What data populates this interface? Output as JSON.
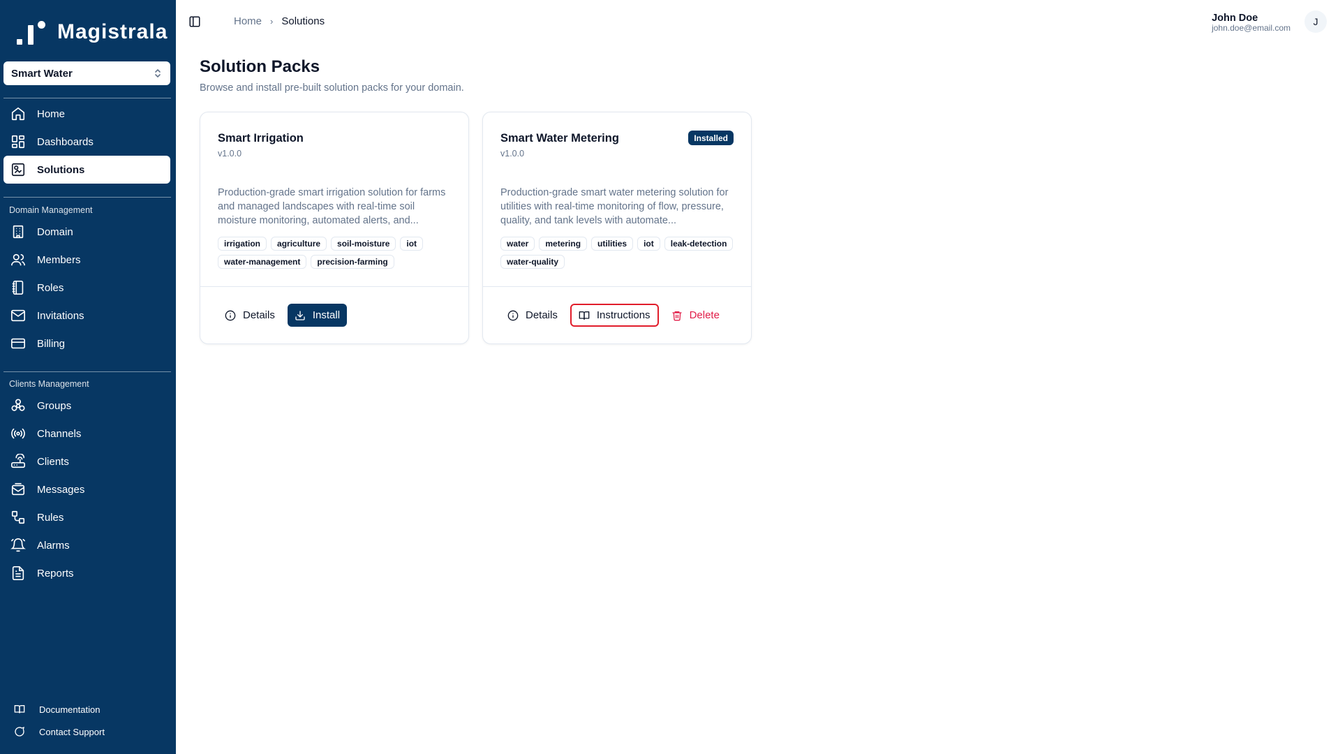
{
  "app": {
    "logo_text": "Magistrala"
  },
  "domain_selector": {
    "value": "Smart Water"
  },
  "sidebar": {
    "main_items": [
      {
        "label": "Home",
        "icon": "home-icon"
      },
      {
        "label": "Dashboards",
        "icon": "dashboard-icon"
      },
      {
        "label": "Solutions",
        "icon": "solutions-icon",
        "active": true
      }
    ],
    "domain_section_label": "Domain Management",
    "domain_items": [
      {
        "label": "Domain",
        "icon": "building-icon"
      },
      {
        "label": "Members",
        "icon": "users-icon"
      },
      {
        "label": "Roles",
        "icon": "notebook-icon"
      },
      {
        "label": "Invitations",
        "icon": "mail-icon"
      },
      {
        "label": "Billing",
        "icon": "credit-card-icon"
      }
    ],
    "clients_section_label": "Clients Management",
    "clients_items": [
      {
        "label": "Groups",
        "icon": "groups-icon"
      },
      {
        "label": "Channels",
        "icon": "radio-icon"
      },
      {
        "label": "Clients",
        "icon": "router-icon"
      },
      {
        "label": "Messages",
        "icon": "mail-open-icon"
      },
      {
        "label": "Rules",
        "icon": "workflow-icon"
      },
      {
        "label": "Alarms",
        "icon": "bell-icon"
      },
      {
        "label": "Reports",
        "icon": "file-text-icon"
      }
    ],
    "footer": [
      {
        "label": "Documentation",
        "icon": "book-icon"
      },
      {
        "label": "Contact Support",
        "icon": "message-circle-icon"
      }
    ]
  },
  "header": {
    "breadcrumb": {
      "home": "Home",
      "current": "Solutions"
    },
    "user": {
      "name": "John Doe",
      "email": "john.doe@email.com",
      "initial": "J"
    }
  },
  "page": {
    "title": "Solution Packs",
    "subtitle": "Browse and install pre-built solution packs for your domain."
  },
  "cards": [
    {
      "title": "Smart Irrigation",
      "version": "v1.0.0",
      "description": "Production-grade smart irrigation solution for farms and managed landscapes with real-time soil moisture monitoring, automated alerts, and...",
      "tags": [
        "irrigation",
        "agriculture",
        "soil-moisture",
        "iot",
        "water-management",
        "precision-farming"
      ],
      "details_label": "Details",
      "install_label": "Install"
    },
    {
      "title": "Smart Water Metering",
      "version": "v1.0.0",
      "badge": "Installed",
      "description": "Production-grade smart water metering solution for utilities with real-time monitoring of flow, pressure, quality, and tank levels with automate...",
      "tags": [
        "water",
        "metering",
        "utilities",
        "iot",
        "leak-detection",
        "water-quality"
      ],
      "details_label": "Details",
      "instructions_label": "Instructions",
      "delete_label": "Delete"
    }
  ],
  "colors": {
    "sidebar": "#073763",
    "primary": "#073763",
    "danger": "#e11d48",
    "highlight": "#e11d2b"
  }
}
